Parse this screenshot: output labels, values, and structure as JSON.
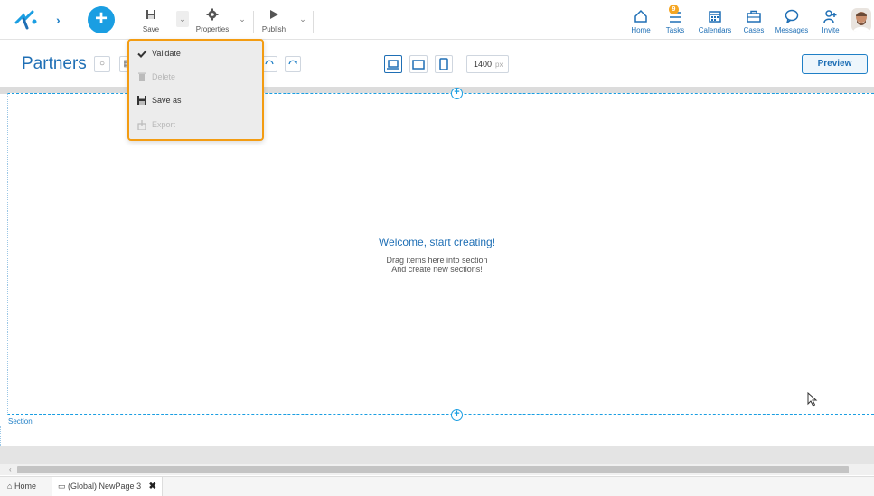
{
  "toolbar": {
    "save_label": "Save",
    "properties_label": "Properties",
    "publish_label": "Publish"
  },
  "nav": {
    "home": "Home",
    "tasks": "Tasks",
    "tasks_badge": "9",
    "calendars": "Calendars",
    "cases": "Cases",
    "messages": "Messages",
    "invite": "Invite"
  },
  "page": {
    "title": "Partners",
    "width_value": "1400",
    "width_unit": "px",
    "preview_label": "Preview"
  },
  "canvas": {
    "welcome": "Welcome, start creating!",
    "hint_line1": "Drag items here into section",
    "hint_line2": "And create new sections!",
    "section_label": "Section"
  },
  "save_menu": {
    "items": [
      {
        "label": "Validate",
        "enabled": true,
        "icon": "check-icon"
      },
      {
        "label": "Delete",
        "enabled": false,
        "icon": "trash-icon"
      },
      {
        "label": "Save as",
        "enabled": true,
        "icon": "save-icon"
      },
      {
        "label": "Export",
        "enabled": false,
        "icon": "export-icon"
      }
    ]
  },
  "tabs": {
    "home": "Home",
    "page": "(Global) NewPage 3"
  },
  "colors": {
    "accent": "#1a9ee2",
    "brand_blue": "#1f6fb5",
    "highlight_border": "#f39c12",
    "badge": "#f5a623"
  }
}
